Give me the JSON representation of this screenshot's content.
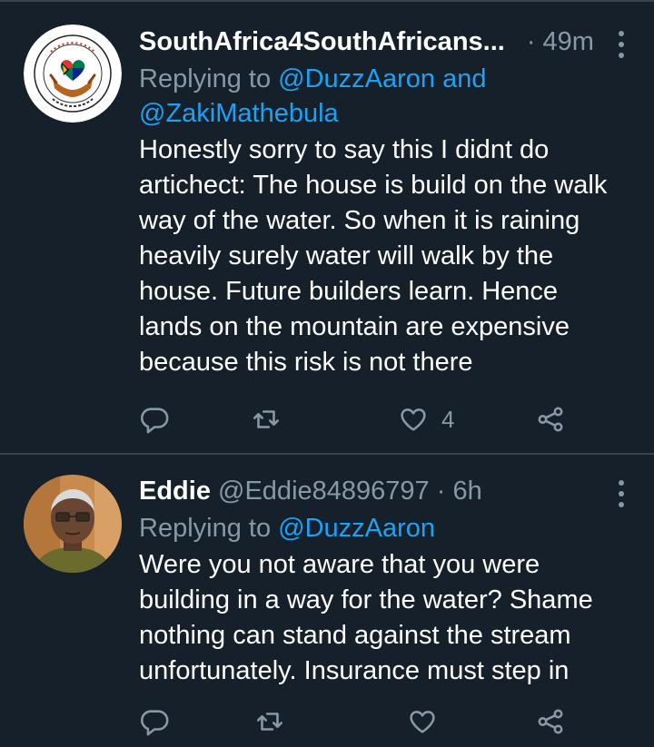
{
  "colors": {
    "background": "#15202b",
    "divider": "#38444d",
    "muted_text": "#8899a6",
    "link": "#1da1f2",
    "icon": "#8899a6"
  },
  "tweets": [
    {
      "display_name": "SouthAfrica4SouthAfricans...",
      "handle": "",
      "time": "· 49m",
      "replying_prefix": "Replying to ",
      "replying_to": "@DuzzAaron and",
      "replying_to_2": "@ZakiMathebula",
      "text_lines": [
        "Honestly sorry to say this I didnt do",
        "artichect: The house is build on the walk",
        "way of the water. So when it is raining",
        "heavily surely water will walk by the",
        "house. Future builders learn. Hence",
        "lands on the mountain are expensive",
        "because this risk is not there"
      ],
      "like_count": "4",
      "avatar_icon": "heart-hands-logo-icon"
    },
    {
      "display_name": "Eddie",
      "handle": " @Eddie84896797",
      "time": " · 6h",
      "replying_prefix": "Replying to ",
      "replying_to": "@DuzzAaron",
      "text_lines": [
        "Were you not aware that you were",
        "building in a way for the water? Shame",
        "nothing can stand against the stream",
        "unfortunately. Insurance must step in"
      ],
      "like_count": "",
      "avatar_icon": "person-photo-icon"
    }
  ],
  "icons": {
    "reply": "reply-bubble-icon",
    "retweet": "retweet-icon",
    "like": "heart-icon",
    "share": "share-icon",
    "more": "more-vertical-icon"
  }
}
